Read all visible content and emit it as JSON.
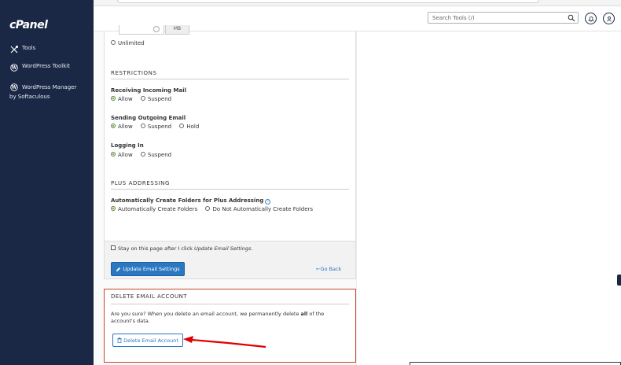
{
  "sidebar": {
    "logo": "cPanel",
    "items": [
      {
        "label": "Tools",
        "icon": "tools-icon"
      },
      {
        "label": "WordPress Toolkit",
        "icon": "wordpress-icon"
      },
      {
        "label": "WordPress Manager",
        "sub": "by Softaculous",
        "icon": "wordpress-icon"
      }
    ]
  },
  "header": {
    "search_placeholder": "Search Tools (/)"
  },
  "quota": {
    "unit": "MB",
    "unlimited_label": "Unlimited"
  },
  "restrictions": {
    "title": "RESTRICTIONS",
    "incoming": {
      "label": "Receiving Incoming Mail",
      "options": [
        "Allow",
        "Suspend"
      ],
      "selected": "Allow"
    },
    "outgoing": {
      "label": "Sending Outgoing Email",
      "options": [
        "Allow",
        "Suspend",
        "Hold"
      ],
      "selected": "Allow"
    },
    "login": {
      "label": "Logging In",
      "options": [
        "Allow",
        "Suspend"
      ],
      "selected": "Allow"
    }
  },
  "plus_addressing": {
    "title": "PLUS ADDRESSING",
    "label": "Automatically Create Folders for Plus Addressing",
    "options": [
      "Automatically Create Folders",
      "Do Not Automatically Create Folders"
    ],
    "selected": "Automatically Create Folders"
  },
  "footer": {
    "stay_text_prefix": "Stay on this page after I click ",
    "stay_text_em": "Update Email Settings",
    "stay_text_suffix": ".",
    "update_button": "Update Email Settings",
    "go_back": "Go Back"
  },
  "delete_account": {
    "title": "DELETE EMAIL ACCOUNT",
    "text_prefix": "Are you sure? When you delete an email account, we permanently delete ",
    "text_bold": "all",
    "text_suffix": " of the account's data.",
    "button": "Delete Email Account"
  },
  "colors": {
    "sidebar": "#1b2845",
    "primary": "#2a77c2",
    "danger_border": "#c7462b",
    "arrow": "#e00000",
    "radio_on": "#55822b"
  }
}
